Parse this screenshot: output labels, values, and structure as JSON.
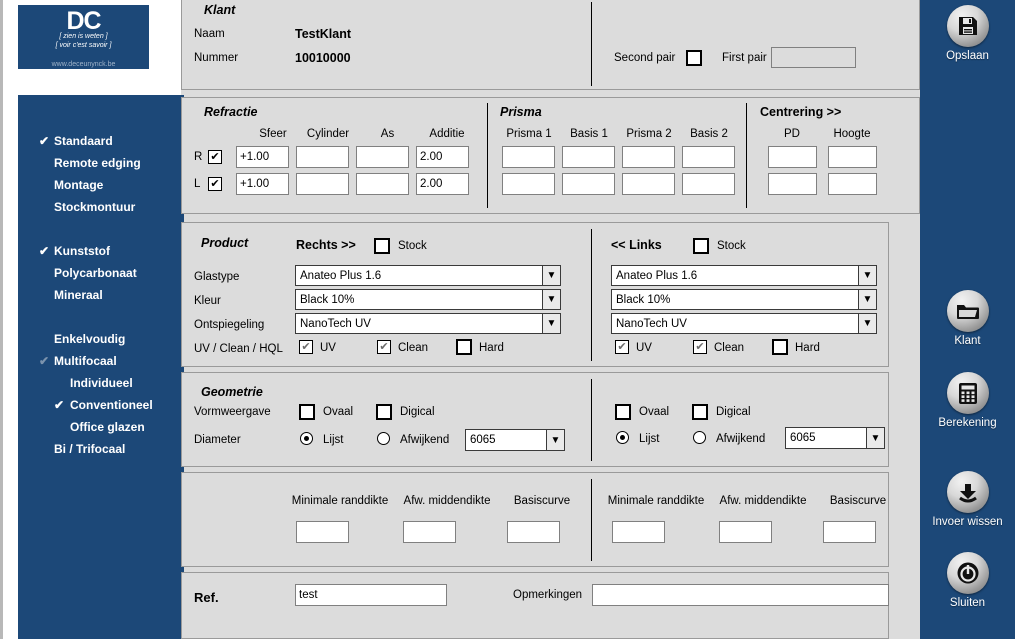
{
  "logo": {
    "mark": "DC",
    "tagline": "[ zien is weten ]\n[ voir c'est savoir ]",
    "url": "www.deceunynck.be"
  },
  "sidebar": {
    "items": [
      {
        "label": "Standaard",
        "checked": true,
        "indent": false,
        "gap": false,
        "dim": false
      },
      {
        "label": "Remote edging",
        "checked": false,
        "indent": false,
        "gap": false,
        "dim": false
      },
      {
        "label": "Montage",
        "checked": false,
        "indent": false,
        "gap": false,
        "dim": false
      },
      {
        "label": "Stockmontuur",
        "checked": false,
        "indent": false,
        "gap": false,
        "dim": false
      },
      {
        "label": "Kunststof",
        "checked": true,
        "indent": false,
        "gap": true,
        "dim": false
      },
      {
        "label": "Polycarbonaat",
        "checked": false,
        "indent": false,
        "gap": false,
        "dim": false
      },
      {
        "label": "Mineraal",
        "checked": false,
        "indent": false,
        "gap": false,
        "dim": false
      },
      {
        "label": "Enkelvoudig",
        "checked": false,
        "indent": false,
        "gap": true,
        "dim": false
      },
      {
        "label": "Multifocaal",
        "checked": true,
        "indent": false,
        "gap": false,
        "dim": true
      },
      {
        "label": "Individueel",
        "checked": false,
        "indent": true,
        "gap": false,
        "dim": false
      },
      {
        "label": "Conventioneel",
        "checked": true,
        "indent": true,
        "gap": false,
        "dim": false
      },
      {
        "label": "Office glazen",
        "checked": false,
        "indent": true,
        "gap": false,
        "dim": false
      },
      {
        "label": "Bi / Trifocaal",
        "checked": false,
        "indent": false,
        "gap": false,
        "dim": false
      }
    ]
  },
  "toolbar": {
    "buttons": [
      {
        "label": "Opslaan",
        "icon": "floppy-disk-icon"
      },
      {
        "label": "Klant",
        "icon": "folder-icon"
      },
      {
        "label": "Berekening",
        "icon": "calculator-icon"
      },
      {
        "label": "Invoer wissen",
        "icon": "down-arrow-icon"
      },
      {
        "label": "Sluiten",
        "icon": "power-icon"
      }
    ]
  },
  "klant": {
    "title": "Klant",
    "naam_label": "Naam",
    "naam_value": "TestKlant",
    "nummer_label": "Nummer",
    "nummer_value": "10010000",
    "second_pair_label": "Second pair",
    "second_pair_checked": false,
    "first_pair_label": "First pair",
    "first_pair_value": ""
  },
  "refractie": {
    "title": "Refractie",
    "columns": [
      "Sfeer",
      "Cylinder",
      "As",
      "Additie"
    ],
    "rows": [
      {
        "eye": "R",
        "enabled": true,
        "sfeer": "+1.00",
        "cylinder": "",
        "as": "",
        "additie": "2.00"
      },
      {
        "eye": "L",
        "enabled": true,
        "sfeer": "+1.00",
        "cylinder": "",
        "as": "",
        "additie": "2.00"
      }
    ]
  },
  "prisma": {
    "title": "Prisma",
    "columns": [
      "Prisma 1",
      "Basis 1",
      "Prisma 2",
      "Basis 2"
    ],
    "rows": [
      {
        "prisma1": "",
        "basis1": "",
        "prisma2": "",
        "basis2": ""
      },
      {
        "prisma1": "",
        "basis1": "",
        "prisma2": "",
        "basis2": ""
      }
    ]
  },
  "centrering": {
    "title": "Centrering >>",
    "columns": [
      "PD",
      "Hoogte"
    ],
    "rows": [
      {
        "pd": "",
        "hoogte": ""
      },
      {
        "pd": "",
        "hoogte": ""
      }
    ]
  },
  "product": {
    "title": "Product",
    "labels": {
      "glastype": "Glastype",
      "kleur": "Kleur",
      "ontspiegeling": "Ontspiegeling",
      "uv_clean_hql": "UV / Clean / HQL"
    },
    "right": {
      "header": "Rechts >>",
      "stock_label": "Stock",
      "stock_checked": false,
      "glastype": "Anateo Plus 1.6",
      "kleur": "Black 10%",
      "ontspiegeling": "NanoTech UV",
      "uv_label": "UV",
      "uv_checked": true,
      "clean_label": "Clean",
      "clean_checked": true,
      "hard_label": "Hard",
      "hard_checked": false
    },
    "left": {
      "header": "<< Links",
      "stock_label": "Stock",
      "stock_checked": false,
      "glastype": "Anateo Plus 1.6",
      "kleur": "Black 10%",
      "ontspiegeling": "NanoTech UV",
      "uv_label": "UV",
      "uv_checked": true,
      "clean_label": "Clean",
      "clean_checked": true,
      "hard_label": "Hard",
      "hard_checked": false
    }
  },
  "geometrie": {
    "title": "Geometrie",
    "labels": {
      "vormweergave": "Vormweergave",
      "diameter": "Diameter",
      "min_randdikte": "Minimale randdikte",
      "afw_middendikte": "Afw. middendikte",
      "basiscurve": "Basiscurve"
    },
    "right": {
      "ovaal_label": "Ovaal",
      "ovaal_checked": false,
      "digical_label": "Digical",
      "digical_checked": false,
      "lijst_label": "Lijst",
      "lijst_selected": true,
      "afwijkend_label": "Afwijkend",
      "afwijkend_selected": false,
      "diameter_value": "6065",
      "min_randdikte": "",
      "afw_middendikte": "",
      "basiscurve": ""
    },
    "left": {
      "ovaal_label": "Ovaal",
      "ovaal_checked": false,
      "digical_label": "Digical",
      "digical_checked": false,
      "lijst_label": "Lijst",
      "lijst_selected": true,
      "afwijkend_label": "Afwijkend",
      "afwijkend_selected": false,
      "diameter_value": "6065",
      "min_randdikte": "",
      "afw_middendikte": "",
      "basiscurve": ""
    }
  },
  "footer": {
    "ref_label": "Ref.",
    "ref_value": "test",
    "opmerkingen_label": "Opmerkingen",
    "opmerkingen_value": ""
  },
  "colors": {
    "brand_blue": "#1c4878",
    "panel_bg": "#dcdcdc",
    "field_bg": "#ffffff"
  }
}
